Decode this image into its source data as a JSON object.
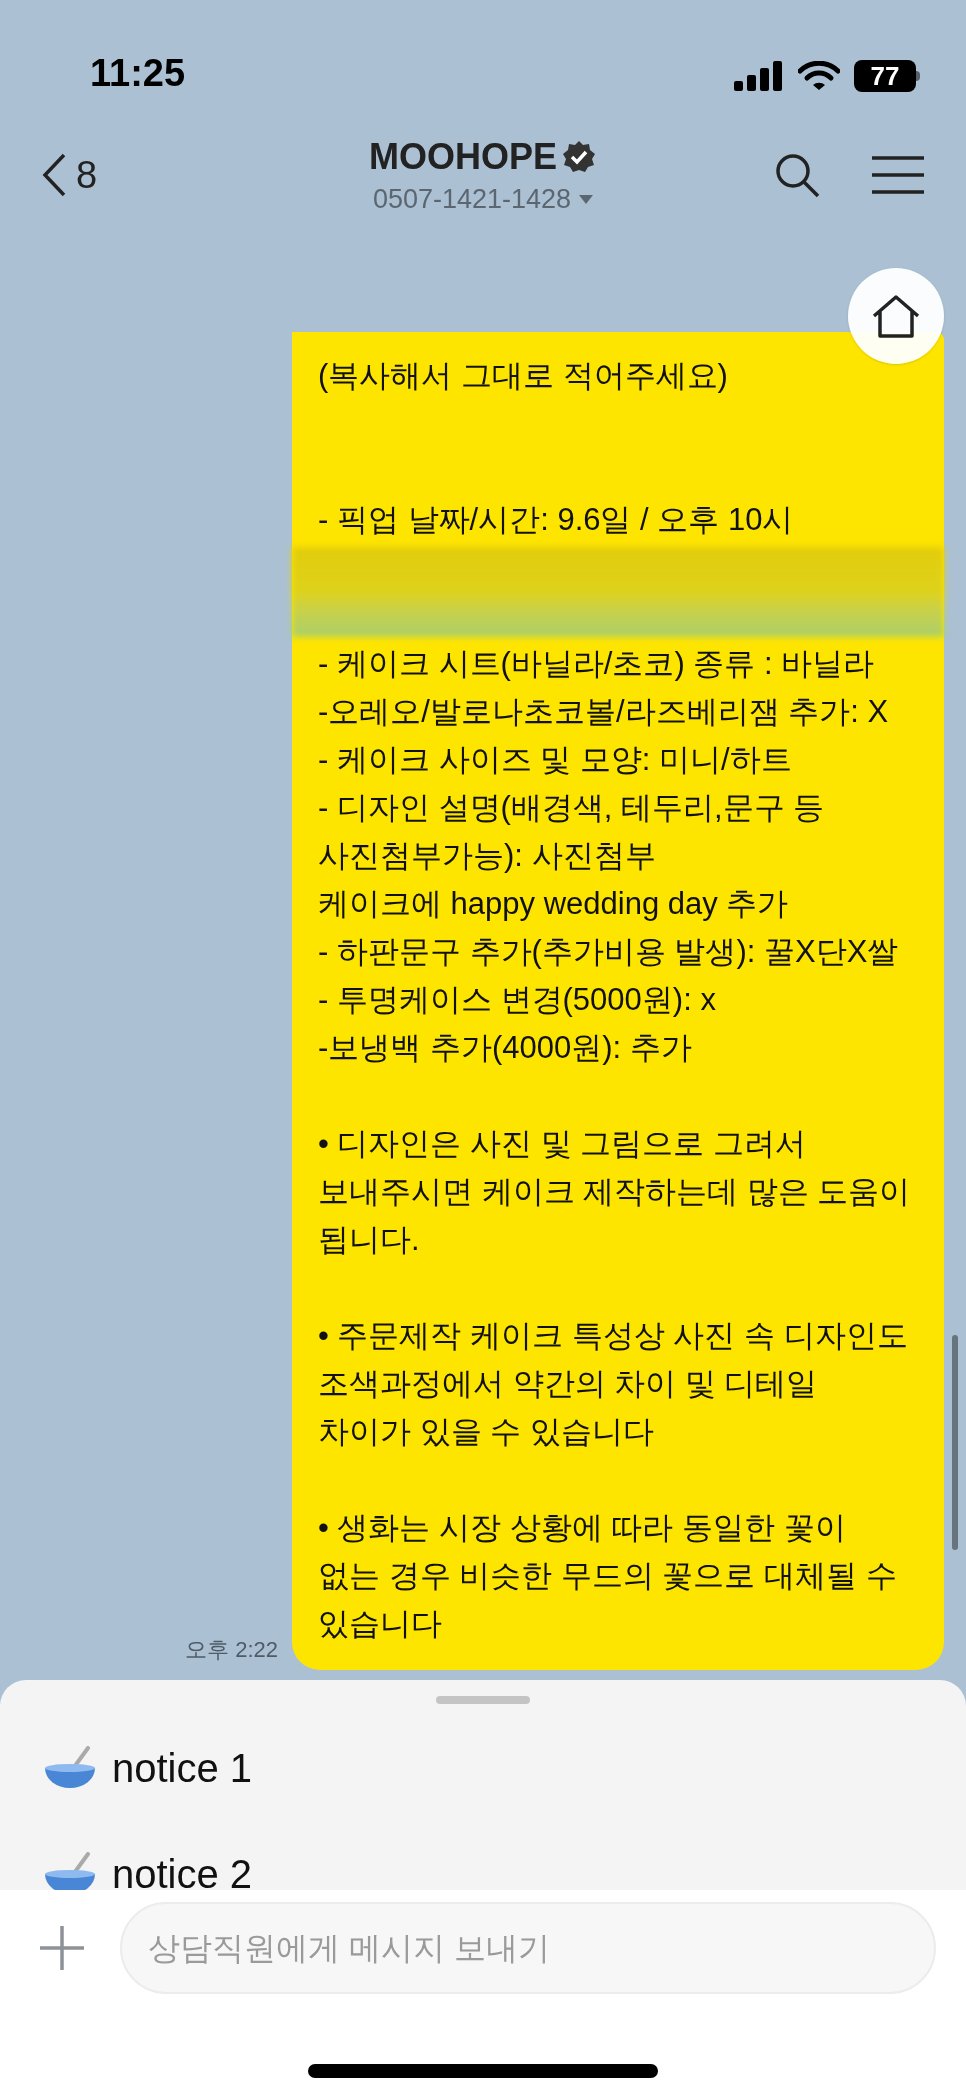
{
  "status_bar": {
    "time": "11:25",
    "battery": "77"
  },
  "header": {
    "back_count": "8",
    "title": "MOOHOPE",
    "verified": true,
    "phone": "0507-1421-1428"
  },
  "message": {
    "time": "오후 2:22",
    "lines": [
      {
        "kind": "text",
        "text": "(복사해서 그대로 적어주세요)"
      },
      {
        "kind": "blank"
      },
      {
        "kind": "blank"
      },
      {
        "kind": "text",
        "text": "- 픽업 날짜/시간: 9.6일 / 오후 10시"
      },
      {
        "kind": "redacted"
      },
      {
        "kind": "text",
        "text": "- 케이크 시트(바닐라/초코) 종류 : 바닐라"
      },
      {
        "kind": "text",
        "text": "-오레오/발로나초코볼/라즈베리잼 추가: X"
      },
      {
        "kind": "text",
        "text": "- 케이크 사이즈 및 모양: 미니/하트"
      },
      {
        "kind": "text",
        "text": "- 디자인 설명(배경색, 테두리,문구 등 사진첨부가능): 사진첨부"
      },
      {
        "kind": "text",
        "text": "케이크에 happy wedding day 추가"
      },
      {
        "kind": "text",
        "text": "- 하판문구 추가(추가비용 발생): 꿀X단X쌀"
      },
      {
        "kind": "text",
        "text": "- 투명케이스 변경(5000원): x"
      },
      {
        "kind": "text",
        "text": "-보냉백 추가(4000원): 추가"
      },
      {
        "kind": "blank"
      },
      {
        "kind": "text",
        "text": "• 디자인은 사진 및 그림으로 그려서 보내주시면 케이크 제작하는데 많은 도움이 됩니다."
      },
      {
        "kind": "blank"
      },
      {
        "kind": "text",
        "text": "• 주문제작 케이크 특성상 사진 속 디자인도 조색과정에서 약간의 차이 및 디테일 차이가 있을 수 있습니다"
      },
      {
        "kind": "blank"
      },
      {
        "kind": "text",
        "text": "• 생화는 시장 상황에 따라 동일한 꽃이 없는 경우 비슷한 무드의 꽃으로 대체될 수 있습니다"
      }
    ]
  },
  "notices": [
    "notice 1",
    "notice 2"
  ],
  "composer": {
    "placeholder": "상담직원에게 메시지 보내기"
  }
}
